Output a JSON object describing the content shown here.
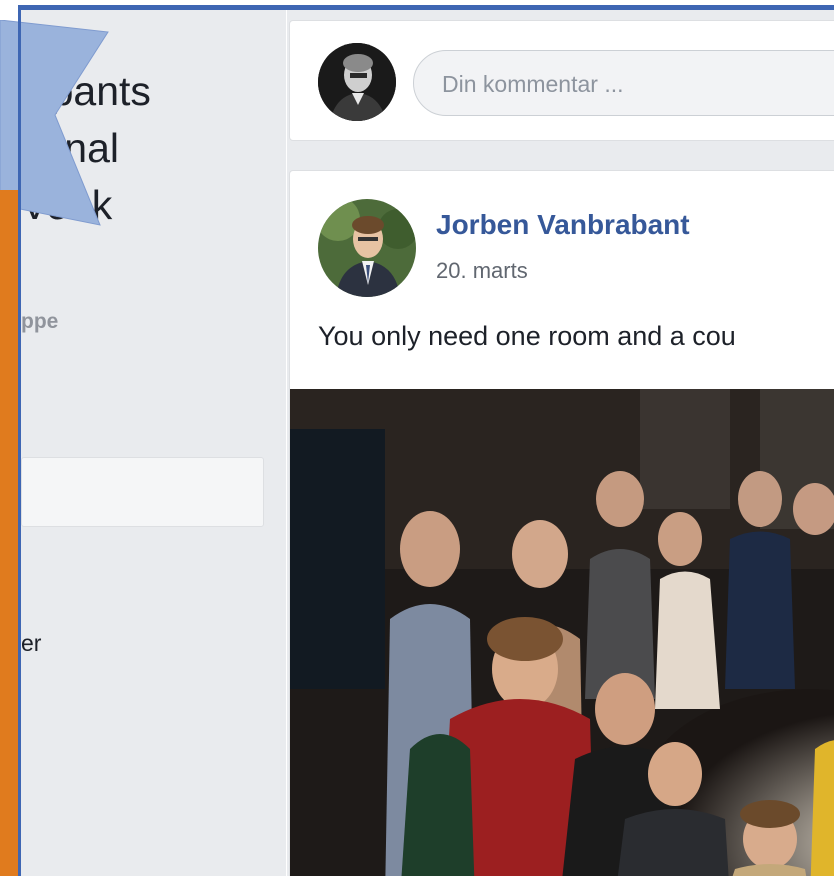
{
  "group": {
    "title_partial": "cipants\ntional\nVeek",
    "subtitle_partial": "ppe",
    "menu_item_partial": "er"
  },
  "composer": {
    "placeholder": "Din kommentar ..."
  },
  "post": {
    "author": "Jorben Vanbrabant",
    "date": "20. marts",
    "text": "You only need one room and a cou"
  },
  "colors": {
    "link": "#365899",
    "accent_orange": "#e07b1e",
    "accent_blue": "#3e66b3",
    "flag": "#9ab3dc"
  }
}
